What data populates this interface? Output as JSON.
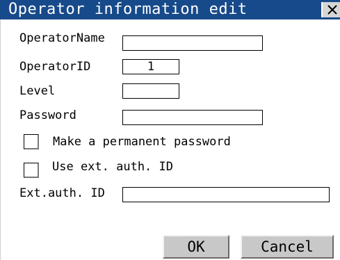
{
  "window": {
    "title": "Operator information edit",
    "close_icon": "close-icon",
    "title_bar_color": "#174a8a"
  },
  "form": {
    "operator_name_label": "OperatorName",
    "operator_name_value": "",
    "operator_id_label": "OperatorID",
    "operator_id_value": "1",
    "level_label": "Level",
    "level_value": "",
    "password_label": "Password",
    "password_value": "",
    "permanent_password_label": "Make a permanent password",
    "permanent_password_checked": false,
    "use_ext_auth_label": "Use ext. auth. ID",
    "use_ext_auth_checked": false,
    "ext_auth_id_label": "Ext.auth. ID",
    "ext_auth_id_value": ""
  },
  "buttons": {
    "ok_label": "OK",
    "cancel_label": "Cancel"
  }
}
